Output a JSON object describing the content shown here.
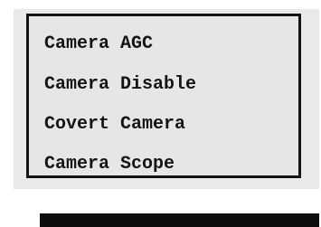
{
  "menu": {
    "items": [
      {
        "label": "Camera AGC"
      },
      {
        "label": "Camera Disable"
      },
      {
        "label": "Covert Camera"
      },
      {
        "label": "Camera Scope"
      }
    ]
  },
  "colors": {
    "panel_background": "#e9e9e9",
    "frame_border": "#141414",
    "text": "#141414",
    "bottom_bar": "#0d0d0d"
  }
}
